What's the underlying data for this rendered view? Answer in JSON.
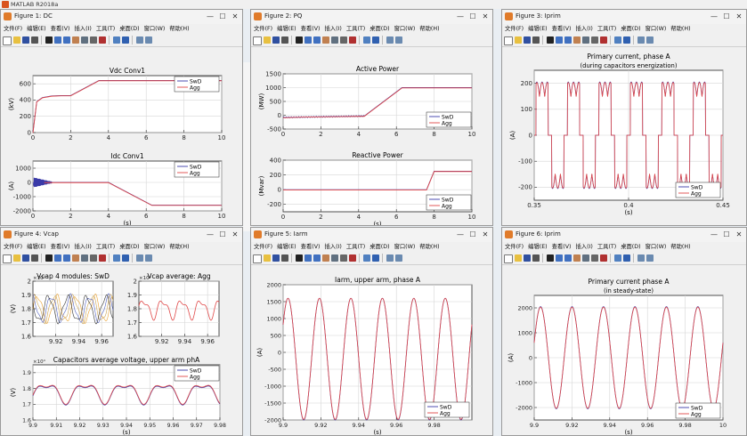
{
  "app": {
    "title": "MATLAB R2018a"
  },
  "menu": [
    "文件(F)",
    "编辑(E)",
    "查看(V)",
    "插入(I)",
    "工具(T)",
    "桌面(D)",
    "窗口(W)",
    "帮助(H)"
  ],
  "colors": {
    "swd": "#3a3aa8",
    "agg": "#e04848",
    "cap1": "#e8a030",
    "cap2": "#c8a050",
    "cap3": "#5060c0",
    "cap4": "#303030"
  },
  "figures": {
    "dc": {
      "title": "Figure 1: DC",
      "ax1": {
        "title": "Vdc Conv1",
        "ylabel": "(kV)",
        "yticks": [
          "0",
          "200",
          "400",
          "600"
        ],
        "xticks": [
          "0",
          "2",
          "4",
          "6",
          "8",
          "10"
        ],
        "legend": [
          "SwD",
          "Agg"
        ]
      },
      "ax2": {
        "title": "Idc Conv1",
        "ylabel": "(A)",
        "yticks": [
          "-2000",
          "-1000",
          "0",
          "1000"
        ],
        "xticks": [
          "0",
          "2",
          "4",
          "6",
          "8",
          "10"
        ],
        "xlabel": "(s)",
        "legend": [
          "SwD",
          "Agg"
        ]
      }
    },
    "pq": {
      "title": "Figure 2: PQ",
      "ax1": {
        "title": "Active Power",
        "ylabel": "(MW)",
        "yticks": [
          "-500",
          "0",
          "500",
          "1000",
          "1500"
        ],
        "xticks": [
          "0",
          "2",
          "4",
          "6",
          "8",
          "10"
        ],
        "legend": [
          "SwD",
          "Agg"
        ]
      },
      "ax2": {
        "title": "Reactive Power",
        "ylabel": "(Mvar)",
        "yticks": [
          "-200",
          "0",
          "200",
          "400"
        ],
        "xticks": [
          "0",
          "2",
          "4",
          "6",
          "8",
          "10"
        ],
        "xlabel": "(s)",
        "legend": [
          "SwD",
          "Agg"
        ]
      }
    },
    "iprim": {
      "title": "Figure 3: Iprim",
      "ax1": {
        "title": "Primary current, phase A",
        "subtitle": "(during capacitors energization)",
        "ylabel": "(A)",
        "yticks": [
          "-200",
          "-100",
          "0",
          "100",
          "200"
        ],
        "xticks": [
          "0.35",
          "0.4",
          "0.45"
        ],
        "xlabel": "(s)",
        "legend": [
          "SwD",
          "Agg"
        ]
      }
    },
    "vcap": {
      "title": "Figure 4: Vcap",
      "ax1": {
        "title": "Vcap 4 modules: SwD",
        "exp": "×10⁴",
        "ylabel": "(V)",
        "yticks": [
          "1.6",
          "1.7",
          "1.8",
          "1.9",
          "2"
        ],
        "xticks": [
          "9.92",
          "9.94",
          "9.96"
        ]
      },
      "ax2": {
        "title": "Vcap average: Agg",
        "exp": "×10⁴",
        "yticks": [
          "1.6",
          "1.7",
          "1.8",
          "1.9",
          "2"
        ],
        "xticks": [
          "9.92",
          "9.94",
          "9.96"
        ]
      },
      "ax3": {
        "title": "Capacitors average voltage, upper arm phA",
        "exp": "×10⁴",
        "ylabel": "(V)",
        "yticks": [
          "1.6",
          "1.7",
          "1.8",
          "1.9"
        ],
        "xticks": [
          "9.9",
          "9.91",
          "9.92",
          "9.93",
          "9.94",
          "9.95",
          "9.96",
          "9.97",
          "9.98"
        ],
        "xlabel": "(s)",
        "legend": [
          "SwD",
          "Agg"
        ]
      }
    },
    "iarm": {
      "title": "Figure 5: Iarm",
      "ax1": {
        "title": "Iarm, upper arm, phase A",
        "ylabel": "(A)",
        "yticks": [
          "-2000",
          "-1500",
          "-1000",
          "-500",
          "0",
          "500",
          "1000",
          "1500",
          "2000"
        ],
        "xticks": [
          "9.9",
          "9.92",
          "9.94",
          "9.96",
          "9.98"
        ],
        "xlabel": "(s)",
        "legend": [
          "SwD",
          "Agg"
        ]
      }
    },
    "iprim2": {
      "title": "Figure 6: Iprim",
      "ax1": {
        "title": "Primary current phase A",
        "subtitle": "(in steady-state)",
        "ylabel": "(A)",
        "yticks": [
          "-2000",
          "-1000",
          "0",
          "1000",
          "2000"
        ],
        "xticks": [
          "9.9",
          "9.92",
          "9.94",
          "9.96",
          "9.98",
          "10"
        ],
        "xlabel": "(s)",
        "legend": [
          "SwD",
          "Agg"
        ]
      }
    }
  },
  "chart_data": [
    {
      "type": "line",
      "title": "Vdc Conv1",
      "ylabel": "(kV)",
      "xlim": [
        0,
        10
      ],
      "ylim": [
        0,
        700
      ],
      "x": [
        0,
        0.2,
        0.5,
        1,
        1.5,
        2,
        3.5,
        4,
        6,
        8,
        10
      ],
      "series": [
        {
          "name": "SwD",
          "values": [
            0,
            380,
            430,
            450,
            455,
            455,
            640,
            640,
            640,
            640,
            640
          ]
        },
        {
          "name": "Agg",
          "values": [
            0,
            380,
            430,
            450,
            455,
            455,
            640,
            640,
            640,
            640,
            640
          ]
        }
      ]
    },
    {
      "type": "line",
      "title": "Idc Conv1",
      "ylabel": "(A)",
      "xlabel": "(s)",
      "xlim": [
        0,
        10
      ],
      "ylim": [
        -2000,
        1500
      ],
      "x": [
        0,
        0.3,
        0.6,
        1,
        2,
        3,
        4,
        6.3,
        8,
        10
      ],
      "series": [
        {
          "name": "SwD",
          "values": [
            0,
            250,
            0,
            0,
            0,
            0,
            0,
            -1600,
            -1600,
            -1600
          ]
        },
        {
          "name": "Agg",
          "values": [
            0,
            250,
            0,
            0,
            0,
            0,
            0,
            -1600,
            -1600,
            -1600
          ]
        }
      ]
    },
    {
      "type": "line",
      "title": "Active Power",
      "ylabel": "(MW)",
      "xlim": [
        0,
        10
      ],
      "ylim": [
        -500,
        1500
      ],
      "x": [
        0,
        1,
        2,
        3,
        4,
        4.3,
        6.3,
        8,
        10
      ],
      "series": [
        {
          "name": "SwD",
          "values": [
            -80,
            -60,
            -50,
            -40,
            -30,
            -30,
            1000,
            1000,
            1000
          ]
        },
        {
          "name": "Agg",
          "values": [
            -80,
            -60,
            -50,
            -40,
            -30,
            -30,
            1000,
            1000,
            1000
          ]
        }
      ]
    },
    {
      "type": "line",
      "title": "Reactive Power",
      "ylabel": "(Mvar)",
      "xlabel": "(s)",
      "xlim": [
        0,
        10
      ],
      "ylim": [
        -300,
        400
      ],
      "x": [
        0,
        2,
        4,
        6,
        7.6,
        8,
        10
      ],
      "series": [
        {
          "name": "SwD",
          "values": [
            0,
            0,
            0,
            0,
            0,
            250,
            250
          ]
        },
        {
          "name": "Agg",
          "values": [
            0,
            0,
            0,
            0,
            0,
            250,
            250
          ]
        }
      ]
    },
    {
      "type": "line",
      "title": "Primary current, phase A",
      "subtitle": "(during capacitors energization)",
      "ylabel": "(A)",
      "xlabel": "(s)",
      "xlim": [
        0.35,
        0.45
      ],
      "ylim": [
        -250,
        250
      ],
      "series": [
        {
          "name": "SwD",
          "description": "pulsed 60 Hz waveform peaking near ±200 A"
        },
        {
          "name": "Agg",
          "description": "pulsed 60 Hz waveform peaking near ±200 A"
        }
      ]
    },
    {
      "type": "line",
      "title": "Vcap 4 modules: SwD",
      "ylabel": "(V)",
      "xlim": [
        9.9,
        9.97
      ],
      "ylim": [
        16000,
        20000
      ]
    },
    {
      "type": "line",
      "title": "Vcap average: Agg",
      "xlim": [
        9.9,
        9.97
      ],
      "ylim": [
        16000,
        20000
      ]
    },
    {
      "type": "line",
      "title": "Capacitors average voltage, upper arm phA",
      "ylabel": "(V)",
      "xlabel": "(s)",
      "xlim": [
        9.9,
        9.98
      ],
      "ylim": [
        16000,
        19500
      ],
      "series": [
        {
          "name": "SwD"
        },
        {
          "name": "Agg"
        }
      ]
    },
    {
      "type": "line",
      "title": "Iarm, upper arm, phase A",
      "ylabel": "(A)",
      "xlabel": "(s)",
      "xlim": [
        9.9,
        10
      ],
      "ylim": [
        -2000,
        2000
      ],
      "series": [
        {
          "name": "SwD",
          "amplitude": 1800,
          "frequency_hz": 60
        },
        {
          "name": "Agg",
          "amplitude": 1800,
          "frequency_hz": 60
        }
      ]
    },
    {
      "type": "line",
      "title": "Primary current phase A",
      "subtitle": "(in steady-state)",
      "ylabel": "(A)",
      "xlabel": "(s)",
      "xlim": [
        9.9,
        10
      ],
      "ylim": [
        -2500,
        2500
      ],
      "series": [
        {
          "name": "SwD",
          "amplitude": 2050,
          "frequency_hz": 60
        },
        {
          "name": "Agg",
          "amplitude": 2050,
          "frequency_hz": 60
        }
      ]
    }
  ]
}
